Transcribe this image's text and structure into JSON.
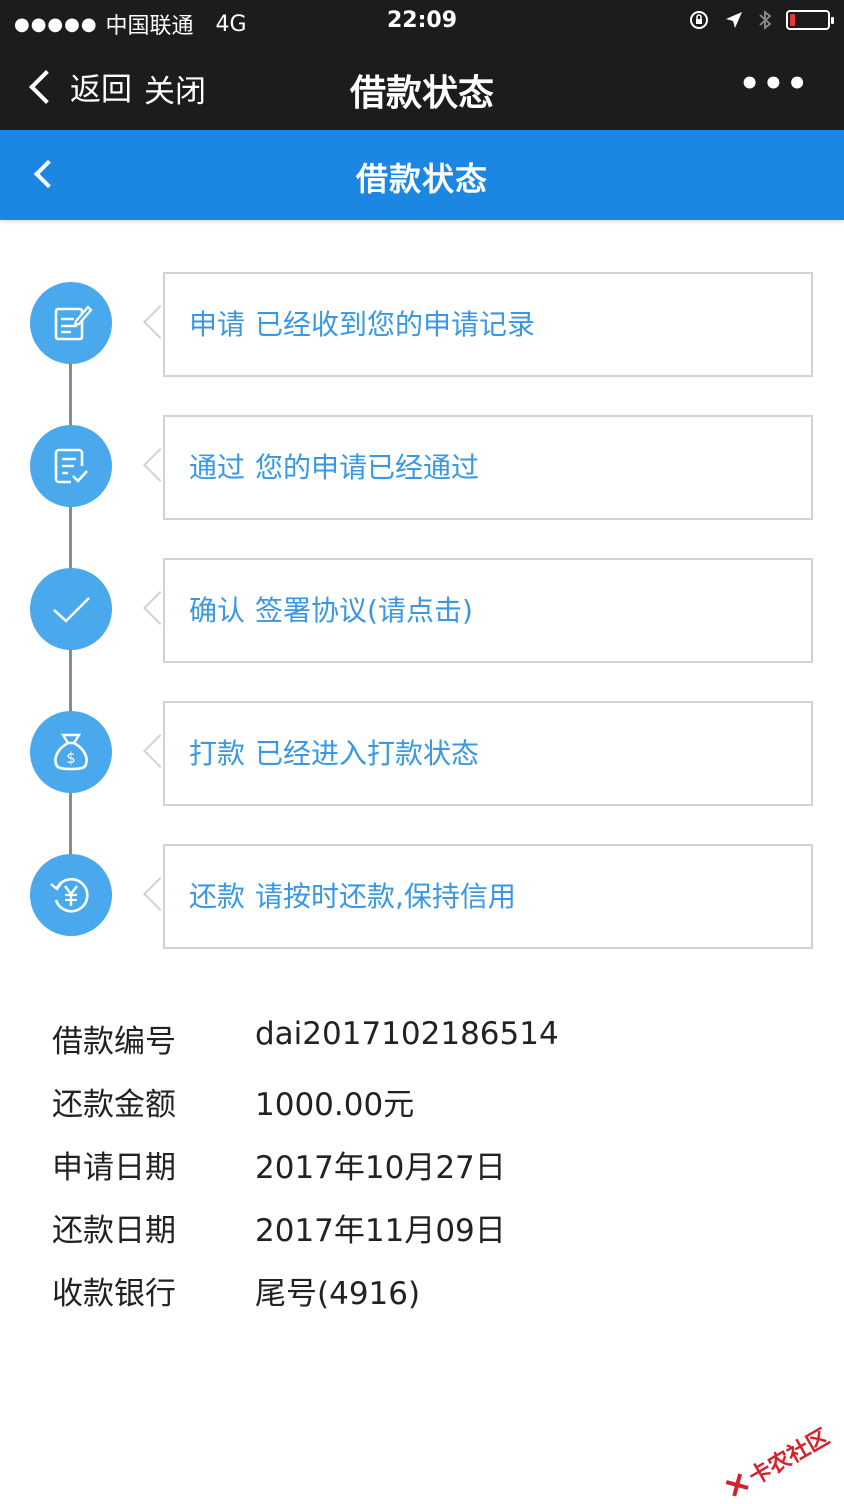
{
  "status_bar": {
    "signal": "●●●●●",
    "carrier": "中国联通",
    "network": "4G",
    "time": "22:09",
    "battery_color": "#e53935",
    "battery_level": 0.15
  },
  "wx_nav": {
    "back_label": "返回",
    "close_label": "关闭",
    "title": "借款状态",
    "more_label": "•••"
  },
  "page_header": {
    "title": "借款状态",
    "accent": "#1b87e3"
  },
  "steps": [
    {
      "icon": "edit-document-icon",
      "title": "申请",
      "desc": "已经收到您的申请记录"
    },
    {
      "icon": "document-check-icon",
      "title": "通过",
      "desc": "您的申请已经通过"
    },
    {
      "icon": "checkmark-icon",
      "title": "确认",
      "desc": "签署协议(请点击)"
    },
    {
      "icon": "money-bag-icon",
      "title": "打款",
      "desc": "已经进入打款状态"
    },
    {
      "icon": "yuan-refresh-icon",
      "title": "还款",
      "desc": "请按时还款,保持信用"
    }
  ],
  "info": [
    {
      "label": "借款编号",
      "value": "dai2017102186514"
    },
    {
      "label": "还款金额",
      "value": "1000.00元"
    },
    {
      "label": "申请日期",
      "value": "2017年10月27日"
    },
    {
      "label": "还款日期",
      "value": "2017年11月09日"
    },
    {
      "label": "收款银行",
      "value": "尾号(4916)"
    }
  ],
  "watermark": {
    "text": "卡农社区"
  }
}
